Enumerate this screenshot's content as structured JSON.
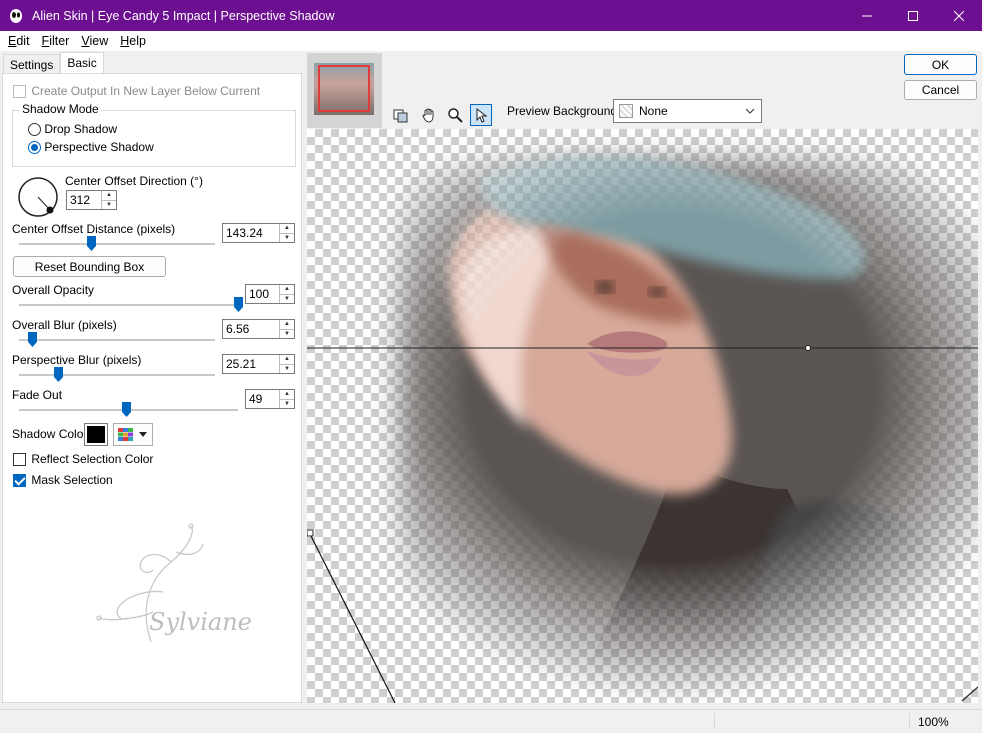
{
  "window": {
    "title": "Alien Skin | Eye Candy 5 Impact | Perspective Shadow",
    "accent_color": "#6d0f91"
  },
  "menu": {
    "items": [
      {
        "key": "E",
        "rest": "dit"
      },
      {
        "key": "F",
        "rest": "ilter"
      },
      {
        "key": "V",
        "rest": "iew"
      },
      {
        "key": "H",
        "rest": "elp"
      }
    ]
  },
  "tabs": {
    "settings": "Settings",
    "basic": "Basic",
    "active": "Basic"
  },
  "basic": {
    "create_output_label": "Create Output In New Layer Below Current",
    "shadow_mode": {
      "title": "Shadow Mode",
      "drop_shadow": "Drop Shadow",
      "perspective_shadow": "Perspective Shadow",
      "selected": "Perspective Shadow"
    },
    "center_offset_direction": {
      "label": "Center Offset Direction (°)",
      "value": "312"
    },
    "center_offset_distance": {
      "label": "Center Offset Distance (pixels)",
      "value": "143.24",
      "fraction": 0.37
    },
    "reset_bounding_box": "Reset Bounding Box",
    "overall_opacity": {
      "label": "Overall Opacity",
      "value": "100",
      "fraction": 1.0
    },
    "overall_blur": {
      "label": "Overall Blur (pixels)",
      "value": "6.56",
      "fraction": 0.07
    },
    "perspective_blur": {
      "label": "Perspective Blur (pixels)",
      "value": "25.21",
      "fraction": 0.2
    },
    "fade_out": {
      "label": "Fade Out",
      "value": "49",
      "fraction": 0.49
    },
    "shadow_color": {
      "label": "Shadow Color",
      "value": "#000000"
    },
    "reflect_selection_color": {
      "label": "Reflect Selection Color",
      "checked": false
    },
    "mask_selection": {
      "label": "Mask Selection",
      "checked": true
    }
  },
  "watermark": "Sylviane",
  "buttons": {
    "ok": "OK",
    "cancel": "Cancel"
  },
  "preview": {
    "background_label": "Preview Background:",
    "background_value": "None"
  },
  "status": {
    "zoom": "100%"
  }
}
